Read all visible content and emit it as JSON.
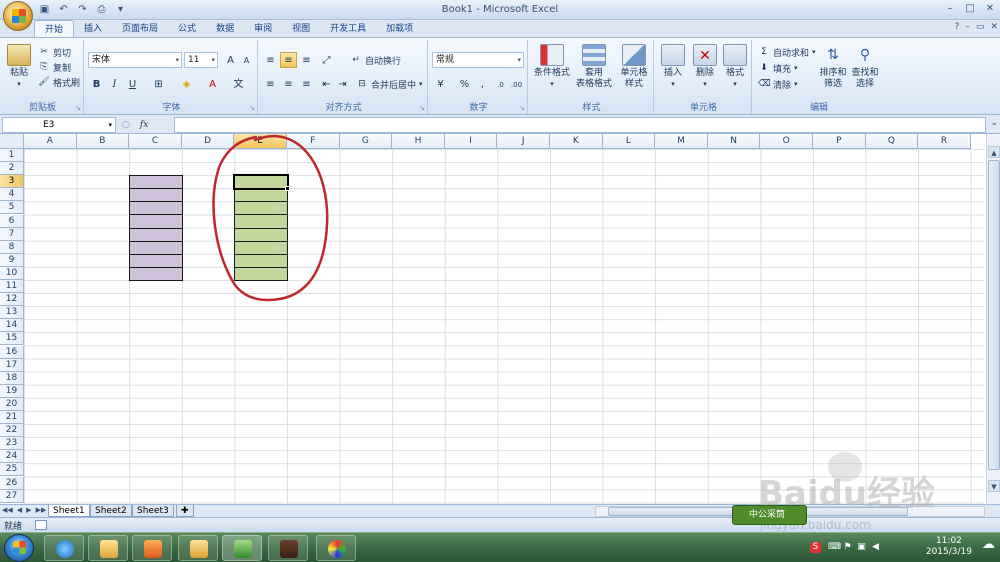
{
  "window": {
    "title": "Book1 - Microsoft Excel",
    "controls": [
      "–",
      "□",
      "✕"
    ]
  },
  "quick_access": [
    "save-icon",
    "undo-icon",
    "redo-icon",
    "print-preview-icon",
    "customize-icon"
  ],
  "tabs": [
    {
      "label": "开始",
      "active": true
    },
    {
      "label": "插入"
    },
    {
      "label": "页面布局"
    },
    {
      "label": "公式"
    },
    {
      "label": "数据"
    },
    {
      "label": "审阅"
    },
    {
      "label": "视图"
    },
    {
      "label": "开发工具"
    },
    {
      "label": "加载项"
    }
  ],
  "ribbon": {
    "clipboard": {
      "paste": "粘贴",
      "cut": "剪切",
      "copy": "复制",
      "format_painter": "格式刷",
      "label": "剪贴板"
    },
    "font": {
      "name": "宋体",
      "size": "11",
      "bold": "B",
      "italic": "I",
      "underline": "U",
      "label": "字体"
    },
    "alignment": {
      "wrap": "自动换行",
      "merge": "合并后居中",
      "label": "对齐方式"
    },
    "number": {
      "format": "常规",
      "percent": "%",
      "label": "数字"
    },
    "styles": {
      "conditional": "条件格式",
      "table1": "套用",
      "table2": "表格格式",
      "cell1": "单元格",
      "cell2": "样式",
      "label": "样式"
    },
    "cells": {
      "insert": "插入",
      "delete": "删除",
      "format": "格式",
      "label": "单元格"
    },
    "editing": {
      "autosum": "自动求和",
      "fill": "填充",
      "clear": "清除",
      "sort1": "排序和",
      "sort2": "筛选",
      "find1": "查找和",
      "find2": "选择",
      "label": "编辑"
    }
  },
  "formula_bar": {
    "name_box": "E3",
    "fx": "fx",
    "value": ""
  },
  "columns": [
    "A",
    "B",
    "C",
    "D",
    "E",
    "F",
    "G",
    "H",
    "I",
    "J",
    "K",
    "L",
    "M",
    "N",
    "O",
    "P",
    "Q",
    "R"
  ],
  "selected_column": "E",
  "rows": [
    "1",
    "2",
    "3",
    "4",
    "5",
    "6",
    "7",
    "8",
    "9",
    "10",
    "11",
    "12",
    "13",
    "14",
    "15",
    "16",
    "17",
    "18",
    "19",
    "20",
    "21",
    "22",
    "23",
    "24",
    "25",
    "26",
    "27"
  ],
  "selected_row": "3",
  "sheets": [
    "Sheet1",
    "Sheet2",
    "Sheet3"
  ],
  "active_sheet": "Sheet1",
  "status": {
    "text": "就绪"
  },
  "colors": {
    "purple_block": "#cec1da",
    "green_block": "#c3d69b",
    "annotation": "#c0272d"
  },
  "taskbar": {
    "time": "11:02",
    "date": "2015/3/19"
  },
  "watermark": {
    "logo": "Baidu经验",
    "sub": "jingyan.baidu.com",
    "stamp": "中公采筒"
  }
}
